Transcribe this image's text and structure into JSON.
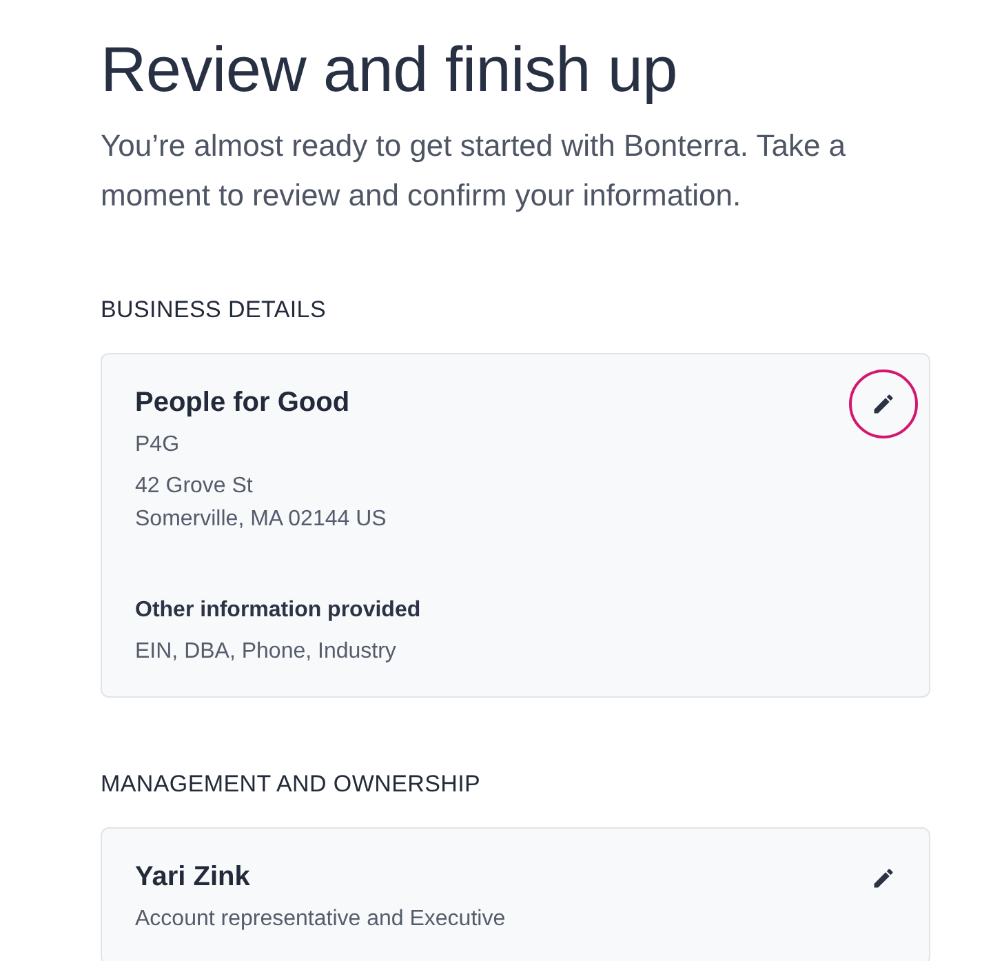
{
  "page": {
    "title": "Review and finish up",
    "intro": "You’re almost ready to get started with Bonterra. Take a moment to review and confirm your information."
  },
  "sections": [
    {
      "heading": "BUSINESS DETAILS",
      "card": {
        "name": "People for Good",
        "edit_button": {
          "focused": true
        },
        "groups": [
          {
            "kind": "lines",
            "lines": [
              "P4G"
            ]
          },
          {
            "kind": "lines",
            "lines": [
              "42 Grove St",
              "Somerville, MA 02144 US"
            ]
          },
          {
            "kind": "labeled",
            "label": "Other information provided",
            "text": "EIN, DBA, Phone, Industry"
          }
        ]
      }
    },
    {
      "heading": "MANAGEMENT AND OWNERSHIP",
      "card": {
        "name": "Yari Zink",
        "edit_button": {
          "focused": false
        },
        "groups": [
          {
            "kind": "lines",
            "lines": [
              "Account representative and Executive"
            ]
          }
        ]
      }
    }
  ]
}
